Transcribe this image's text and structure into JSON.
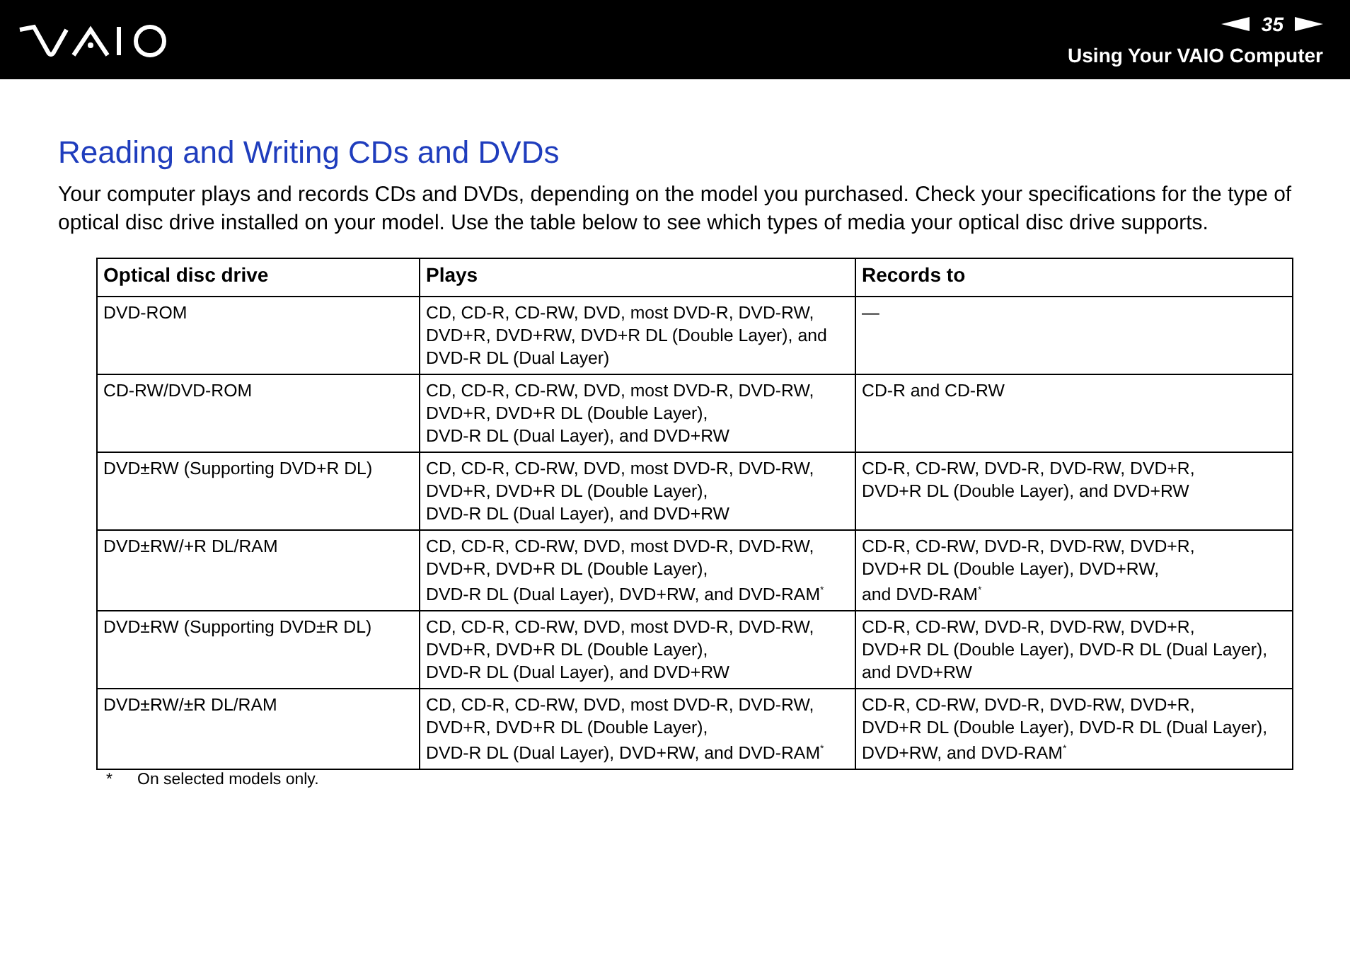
{
  "header": {
    "page_number": "35",
    "section": "Using Your VAIO Computer"
  },
  "title": "Reading and Writing CDs and DVDs",
  "intro": "Your computer plays and records CDs and DVDs, depending on the model you purchased. Check your specifications for the type of optical disc drive installed on your model. Use the table below to see which types of media your optical disc drive supports.",
  "table": {
    "columns": [
      "Optical disc drive",
      "Plays",
      "Records to"
    ],
    "rows": [
      [
        [
          "DVD-ROM"
        ],
        [
          "CD, CD-R, CD-RW, DVD, most DVD-R, DVD-RW,",
          "DVD+R, DVD+RW, DVD+R DL (Double Layer), and",
          "DVD-R DL (Dual Layer)"
        ],
        [
          "—"
        ]
      ],
      [
        [
          "CD-RW/DVD-ROM"
        ],
        [
          "CD, CD-R, CD-RW, DVD, most DVD-R, DVD-RW,",
          "DVD+R, DVD+R DL (Double Layer),",
          "DVD-R DL (Dual Layer), and DVD+RW"
        ],
        [
          "CD-R and CD-RW"
        ]
      ],
      [
        [
          "DVD±RW (Supporting DVD+R DL)"
        ],
        [
          "CD, CD-R, CD-RW, DVD, most DVD-R, DVD-RW,",
          "DVD+R, DVD+R DL (Double Layer),",
          "DVD-R DL (Dual Layer), and DVD+RW"
        ],
        [
          "CD-R, CD-RW, DVD-R, DVD-RW, DVD+R,",
          "DVD+R DL (Double Layer), and DVD+RW"
        ]
      ],
      [
        [
          "DVD±RW/+R DL/RAM"
        ],
        [
          "CD, CD-R, CD-RW, DVD, most DVD-R, DVD-RW,",
          "DVD+R, DVD+R DL (Double Layer),",
          "DVD-R DL (Dual Layer), DVD+RW, and DVD-RAM$^{*}$"
        ],
        [
          "CD-R, CD-RW, DVD-R, DVD-RW, DVD+R,",
          "DVD+R DL (Double Layer), DVD+RW,",
          "and DVD-RAM$^{*}$"
        ]
      ],
      [
        [
          "DVD±RW (Supporting DVD±R DL)"
        ],
        [
          "CD, CD-R, CD-RW, DVD, most DVD-R, DVD-RW,",
          "DVD+R, DVD+R DL (Double Layer),",
          "DVD-R DL (Dual Layer), and DVD+RW"
        ],
        [
          "CD-R, CD-RW, DVD-R, DVD-RW, DVD+R,",
          "DVD+R DL (Double Layer), DVD-R DL (Dual Layer),",
          "and DVD+RW"
        ]
      ],
      [
        [
          "DVD±RW/±R DL/RAM"
        ],
        [
          "CD, CD-R, CD-RW, DVD, most DVD-R, DVD-RW,",
          "DVD+R, DVD+R DL (Double Layer),",
          "DVD-R DL (Dual Layer), DVD+RW, and DVD-RAM$^{*}$"
        ],
        [
          "CD-R, CD-RW, DVD-R, DVD-RW, DVD+R,",
          "DVD+R DL (Double Layer), DVD-R DL (Dual Layer),",
          "DVD+RW, and DVD-RAM$^{*}$"
        ]
      ]
    ]
  },
  "footnote": {
    "mark": "*",
    "text": "On selected models only."
  }
}
